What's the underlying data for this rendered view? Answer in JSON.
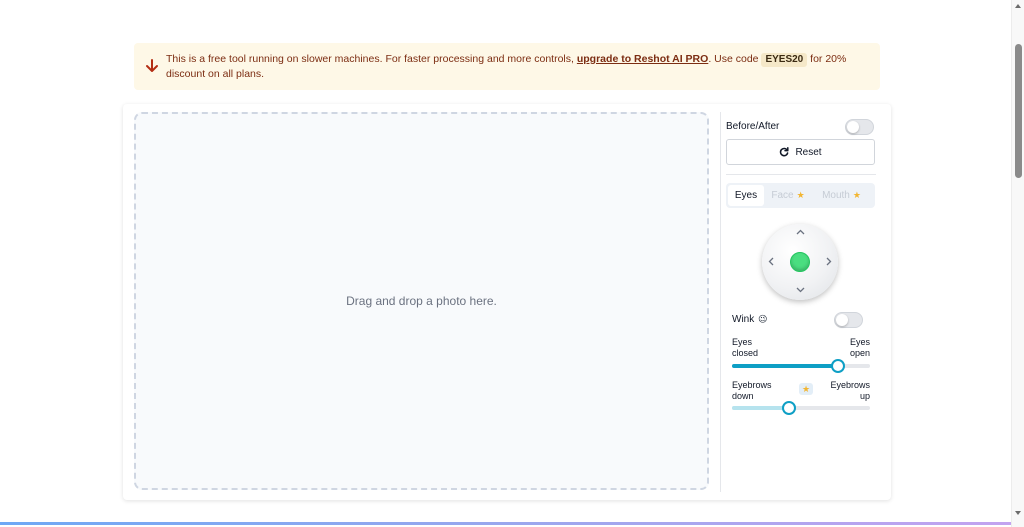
{
  "notice": {
    "text_before": "This is a free tool running on slower machines. For faster processing and more controls, ",
    "link_text": "upgrade to Reshot AI PRO",
    "text_middle": ". Use code ",
    "code": "EYES20",
    "text_after": " for 20% discount on all plans."
  },
  "dropzone": {
    "text": "Drag and drop a photo here."
  },
  "panel": {
    "before_after_label": "Before/After",
    "before_after_on": false,
    "reset_label": "Reset",
    "tabs": [
      {
        "label": "Eyes",
        "active": true,
        "pro": false
      },
      {
        "label": "Face",
        "active": false,
        "pro": true
      },
      {
        "label": "Mouth",
        "active": false,
        "pro": true
      }
    ],
    "joystick": {
      "up": "^",
      "down": "v",
      "left": "<",
      "right": ">"
    },
    "wink_label": "Wink",
    "wink_emoji": "😉",
    "wink_on": false,
    "sliders": [
      {
        "left_label": "Eyes\nclosed",
        "right_label": "Eyes\nopen",
        "value_fraction": 0.77,
        "fill_color": "#0e9fc5"
      },
      {
        "left_label": "Eyebrows\ndown",
        "right_label": "Eyebrows\nup",
        "value_fraction": 0.41,
        "fill_color": "#b6e3ee",
        "pro": true
      }
    ]
  },
  "colors": {
    "accent": "#0e9fc5",
    "notice_bg": "#fef8e7",
    "notice_text": "#7c2d12",
    "joystick_center": "#4ade80",
    "pro_star": "#f2b531"
  }
}
